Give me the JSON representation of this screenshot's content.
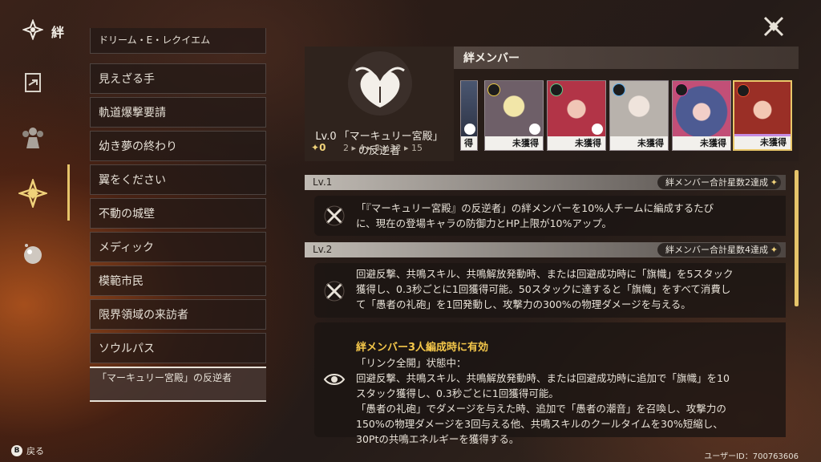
{
  "header": {
    "title": "絆"
  },
  "rail": {
    "items": [
      "emblem-icon",
      "card-export-icon",
      "team-icon",
      "bond-icon",
      "orb-icon"
    ]
  },
  "list": {
    "items": [
      "ドリーム・E・レクイエム",
      "見えざる手",
      "軌道爆撃要請",
      "幼き夢の終わり",
      "翼をください",
      "不動の城壁",
      "メディック",
      "模範市民",
      "限界領域の来訪者",
      "ソウルパス"
    ],
    "selected": "「マーキュリー宮殿」の反逆者"
  },
  "bond": {
    "level_prefix": "Lv.0",
    "name": "「マーキュリー宮殿」の反逆者",
    "stars": "0",
    "thresholds": "2 ▸ 4 ▸ 8 ▸ 12 ▸ 15"
  },
  "members": {
    "title": "絆メンバー",
    "label": "未獲得",
    "partial_label": "得",
    "elements": [
      "#e7c640",
      "#5fd08a",
      "#5aaef0",
      "#e0458f",
      "#e84f2c"
    ]
  },
  "levels": [
    {
      "label": "Lv.1",
      "requirement": "絆メンバー合計星数2達成",
      "text": "「『マーキュリー宮殿』の反逆者」の絆メンバーを10%人チームに編成するたび\nに、現在の登場キャラの防御力とHP上限が10%アップ。"
    },
    {
      "label": "Lv.2",
      "requirement": "絆メンバー合計星数4達成",
      "text": "回避反撃、共鳴スキル、共鳴解放発動時、または回避成功時に「旗幟」を5スタック\n獲得し、0.3秒ごとに1回獲得可能。50スタックに達すると「旗幟」をすべて消費し\nて「愚者の礼砲」を1回発動し、攻撃力の300%の物理ダメージを与える。",
      "bonus_title": "絆メンバー3人編成時に有効",
      "bonus_text": "「リンク全開」状態中：\n回避反撃、共鳴スキル、共鳴解放発動時、または回避成功時に追加で「旗幟」を10\nスタック獲得し、0.3秒ごとに1回獲得可能。\n「愚者の礼砲」でダメージを与えた時、追加で「愚者の潮音」を召喚し、攻撃力の\n150%の物理ダメージを3回与える他、共鳴スキルのクールタイムを30%短縮し、\n30Ptの共鳴エネルギーを獲得する。"
    }
  ],
  "footer": {
    "back_key": "B",
    "back_label": "戻る",
    "user_id": "ユーザーID：700763606"
  }
}
